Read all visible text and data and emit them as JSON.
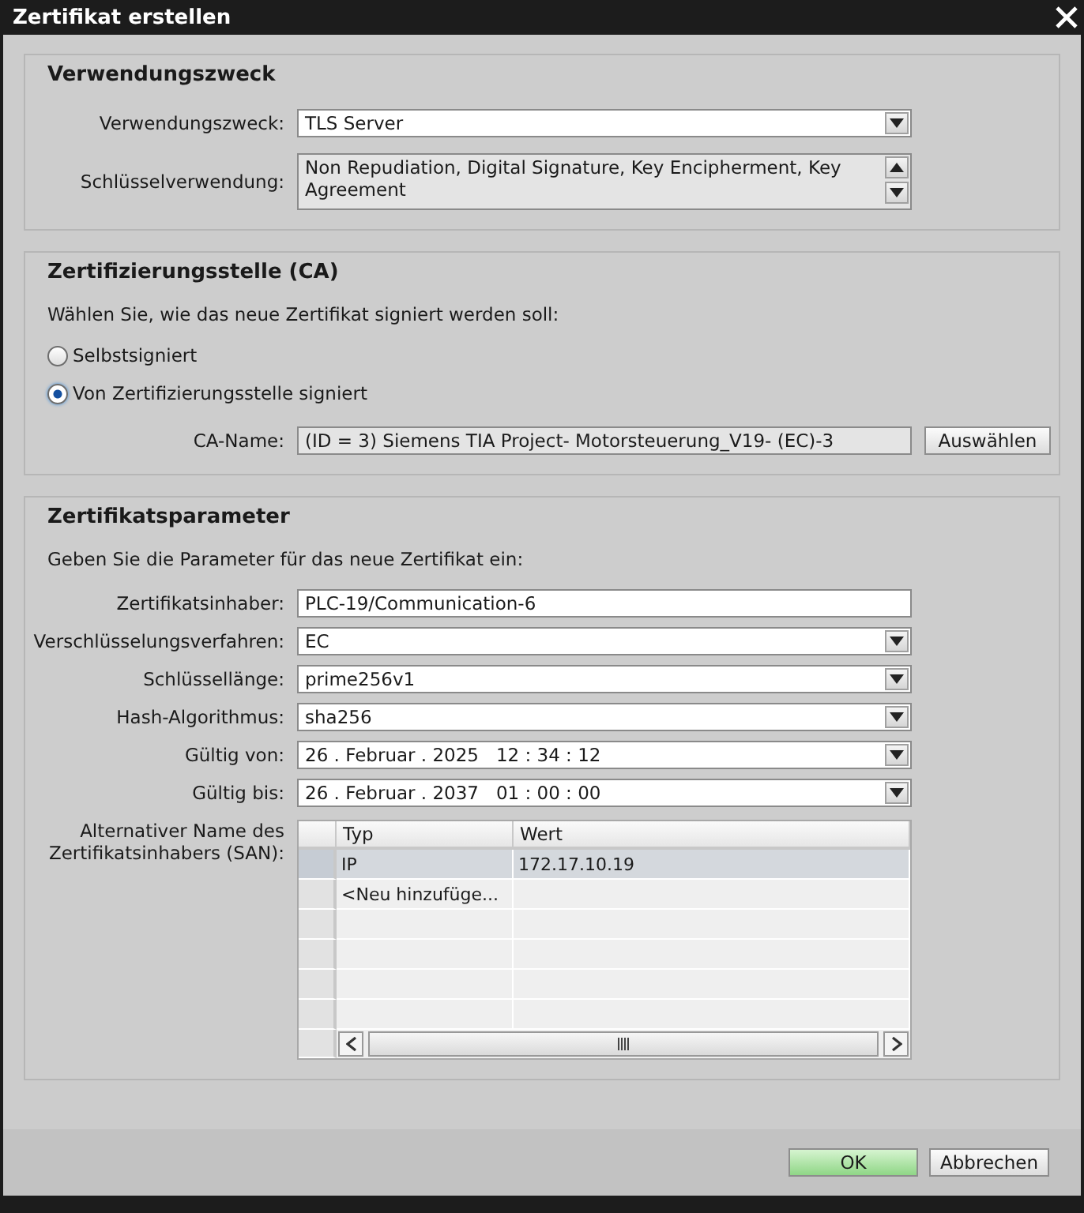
{
  "window": {
    "title": "Zertifikat erstellen"
  },
  "purpose": {
    "heading": "Verwendungszweck",
    "fields": [
      {
        "kind": "dropdown",
        "label": "Verwendungszweck:",
        "value": "TLS Server"
      },
      {
        "kind": "textarea",
        "label": "Schlüsselverwendung:",
        "value": "Non Repudiation, Digital Signature, Key Encipherment, Key Agreement"
      }
    ]
  },
  "ca": {
    "heading": "Zertifizierungsstelle (CA)",
    "prompt": "Wählen Sie, wie das neue Zertifikat signiert werden soll:",
    "options": [
      {
        "label": "Selbstsigniert",
        "selected": false
      },
      {
        "label": "Von Zertifizierungsstelle signiert",
        "selected": true
      }
    ],
    "ca_name": {
      "label": "CA-Name:",
      "value": "(ID = 3) Siemens TIA Project- Motorsteuerung_V19- (EC)-3",
      "button": "Auswählen"
    }
  },
  "parameters": {
    "heading": "Zertifikatsparameter",
    "prompt": "Geben Sie die Parameter für das neue Zertifikat ein:",
    "fields": [
      {
        "kind": "text",
        "label": "Zertifikatsinhaber:",
        "value": "PLC-19/Communication-6"
      },
      {
        "kind": "dropdown",
        "label": "Verschlüsselungsverfahren:",
        "value": "EC"
      },
      {
        "kind": "dropdown",
        "label": "Schlüssellänge:",
        "value": "prime256v1"
      },
      {
        "kind": "dropdown",
        "label": "Hash-Algorithmus:",
        "value": "sha256"
      },
      {
        "kind": "dropdown",
        "label": "Gültig von:",
        "value": "26 . Februar . 2025   12 : 34 : 12"
      },
      {
        "kind": "dropdown",
        "label": "Gültig bis:",
        "value": "26 . Februar . 2037   01 : 00 : 00"
      }
    ],
    "san": {
      "label": "Alternativer Name des Zertifikatsinhabers (SAN):",
      "columns": [
        "Typ",
        "Wert"
      ],
      "rows": [
        {
          "cells": [
            "IP",
            "172.17.10.19"
          ],
          "selected": true
        },
        {
          "cells": [
            "<Neu hinzufüge..."
          ],
          "selected": false
        }
      ]
    }
  },
  "buttons": [
    {
      "label": "OK",
      "default": true
    },
    {
      "label": "Abbrechen",
      "default": false
    }
  ]
}
